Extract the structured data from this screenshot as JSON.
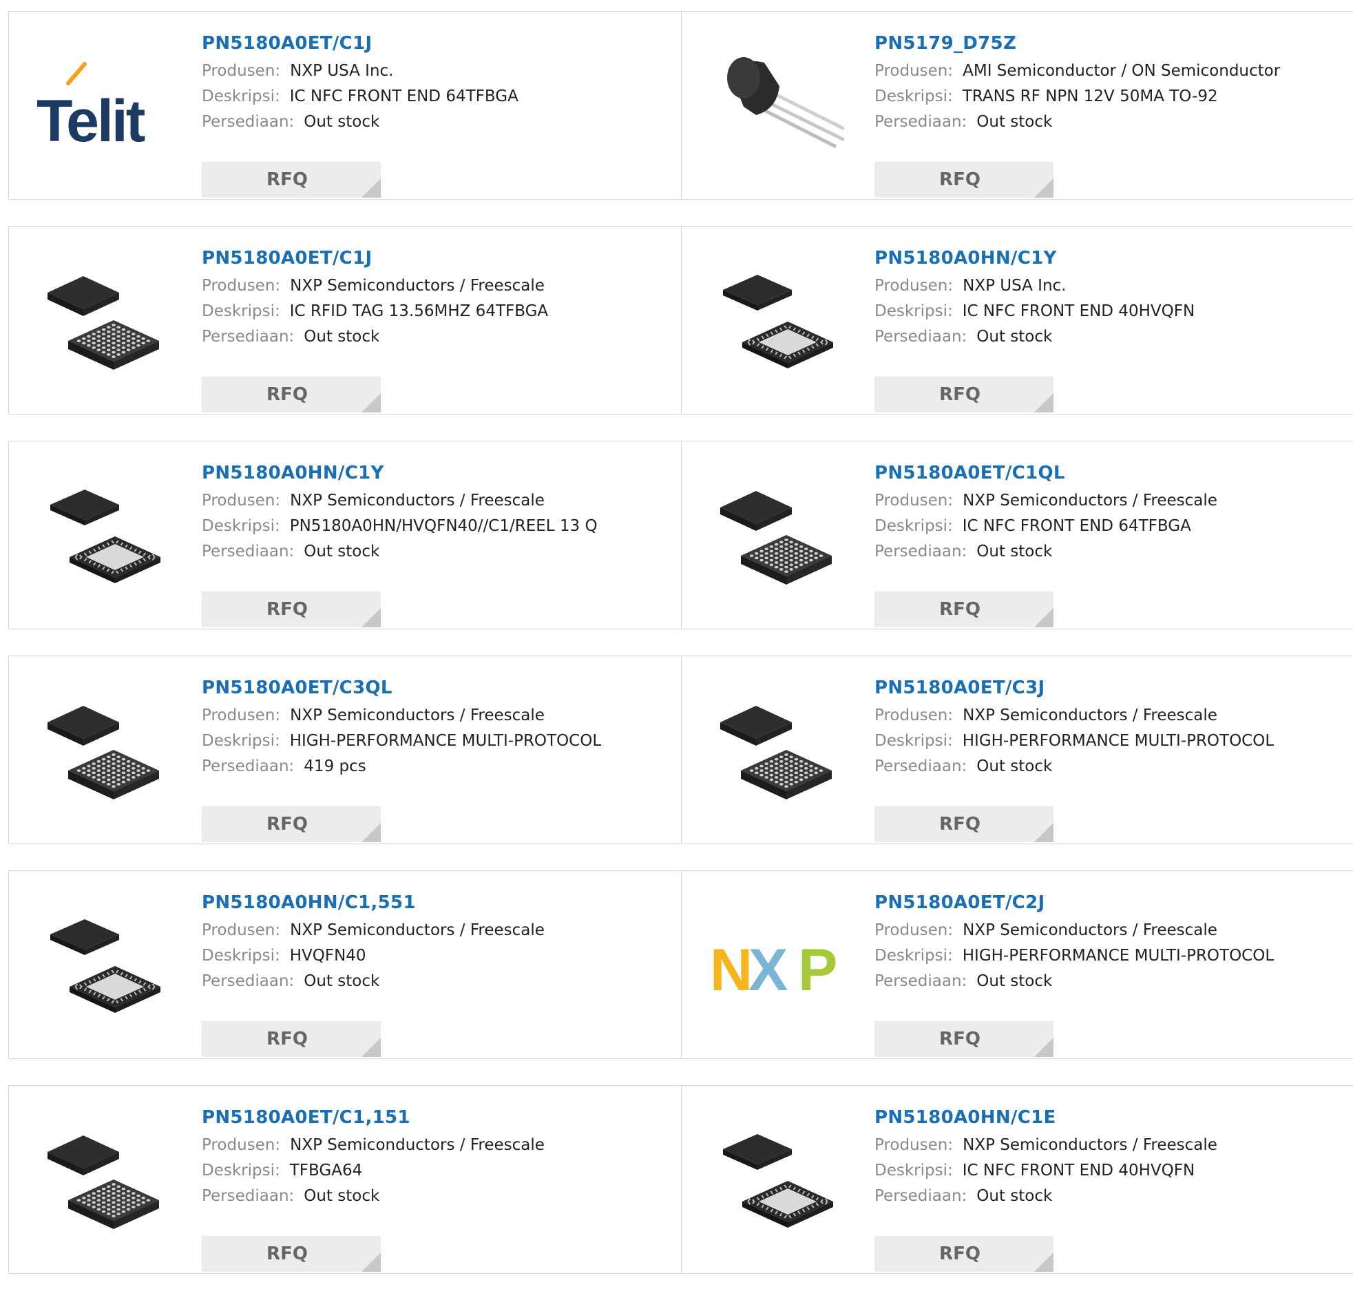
{
  "labels": {
    "manufacturer": "Produsen:",
    "description": "Deskripsi:",
    "stock": "Persediaan:",
    "rfq": "RFQ"
  },
  "logos": {
    "telit": "Telit",
    "nxp": [
      "N",
      "X",
      "P"
    ]
  },
  "products": [
    {
      "part": "PN5180A0ET/C1J",
      "manufacturer": "NXP USA Inc.",
      "description": "IC NFC FRONT END 64TFBGA",
      "stock": "Out stock",
      "image": "telit-logo"
    },
    {
      "part": "PN5179_D75Z",
      "manufacturer": "AMI Semiconductor / ON Semiconductor",
      "description": "TRANS RF NPN 12V 50MA TO-92",
      "stock": "Out stock",
      "image": "to92-transistor"
    },
    {
      "part": "PN5180A0ET/C1J",
      "manufacturer": "NXP Semiconductors / Freescale",
      "description": "IC RFID TAG 13.56MHZ 64TFBGA",
      "stock": "Out stock",
      "image": "bga-chip"
    },
    {
      "part": "PN5180A0HN/C1Y",
      "manufacturer": "NXP USA Inc.",
      "description": "IC NFC FRONT END 40HVQFN",
      "stock": "Out stock",
      "image": "qfn-chip"
    },
    {
      "part": "PN5180A0HN/C1Y",
      "manufacturer": "NXP Semiconductors / Freescale",
      "description": "PN5180A0HN/HVQFN40//C1/REEL 13 Q",
      "stock": "Out stock",
      "image": "qfn-chip"
    },
    {
      "part": "PN5180A0ET/C1QL",
      "manufacturer": "NXP Semiconductors / Freescale",
      "description": "IC NFC FRONT END 64TFBGA",
      "stock": "Out stock",
      "image": "bga-chip"
    },
    {
      "part": "PN5180A0ET/C3QL",
      "manufacturer": "NXP Semiconductors / Freescale",
      "description": "HIGH-PERFORMANCE MULTI-PROTOCOL",
      "stock": "419 pcs",
      "image": "bga-chip"
    },
    {
      "part": "PN5180A0ET/C3J",
      "manufacturer": "NXP Semiconductors / Freescale",
      "description": "HIGH-PERFORMANCE MULTI-PROTOCOL",
      "stock": "Out stock",
      "image": "bga-chip"
    },
    {
      "part": "PN5180A0HN/C1,551",
      "manufacturer": "NXP Semiconductors / Freescale",
      "description": "HVQFN40",
      "stock": "Out stock",
      "image": "qfn-chip"
    },
    {
      "part": "PN5180A0ET/C2J",
      "manufacturer": "NXP Semiconductors / Freescale",
      "description": "HIGH-PERFORMANCE MULTI-PROTOCOL",
      "stock": "Out stock",
      "image": "nxp-logo"
    },
    {
      "part": "PN5180A0ET/C1,151",
      "manufacturer": "NXP Semiconductors / Freescale",
      "description": "TFBGA64",
      "stock": "Out stock",
      "image": "bga-chip"
    },
    {
      "part": "PN5180A0HN/C1E",
      "manufacturer": "NXP Semiconductors / Freescale",
      "description": "IC NFC FRONT END 40HVQFN",
      "stock": "Out stock",
      "image": "qfn-chip"
    }
  ]
}
